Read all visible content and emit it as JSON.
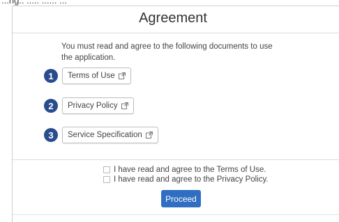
{
  "top_strip_text": "...ng.. ..... ...... ...",
  "dialog": {
    "title": "Agreement",
    "intro": "You must read and agree to the following documents to use the application."
  },
  "documents": [
    {
      "number": "1",
      "label": "Terms of Use"
    },
    {
      "number": "2",
      "label": "Privacy Policy"
    },
    {
      "number": "3",
      "label": "Service Specification"
    }
  ],
  "checkboxes": [
    {
      "label": "I have read and agree to the Terms of Use.",
      "checked": false
    },
    {
      "label": "I have read and agree to the Privacy Policy.",
      "checked": false
    }
  ],
  "proceed_label": "Proceed",
  "colors": {
    "accent": "#2f6ec1",
    "step_badge": "#2a4c8f"
  },
  "icons": {
    "document_link": "external-link-icon"
  }
}
